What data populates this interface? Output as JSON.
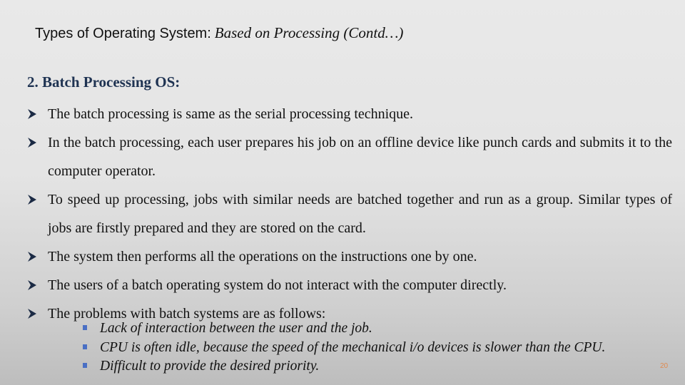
{
  "slide": {
    "title": {
      "main": "Types of Operating System:",
      "sub": "Based on Processing (Contd…)"
    },
    "heading": "2. Batch Processing OS:",
    "bullet_icon": "arrow-bullet-icon",
    "bullets": [
      "The batch processing is same as the serial processing technique.",
      "In the batch processing, each user prepares his job on an offline device like punch cards and submits it to the computer operator.",
      "To speed up processing, jobs with similar needs are batched together and run as a group. Similar types of jobs are firstly prepared and they are stored on the card.",
      "The system then performs all the operations on the instructions one by one.",
      "The users of a batch operating system do not interact with the computer directly.",
      "The problems with batch systems are as follows:"
    ],
    "sub_bullet_icon": "square-bullet-icon",
    "sub_bullets": [
      "Lack of interaction between the user and the job.",
      "CPU is often idle, because the speed of the mechanical i/o devices is slower than the CPU.",
      "Difficult to provide the desired priority."
    ],
    "page_number": "20",
    "colors": {
      "heading": "#1f3352",
      "sub_bullet": "#4a6fc4",
      "page_number": "#e08a4f"
    }
  }
}
